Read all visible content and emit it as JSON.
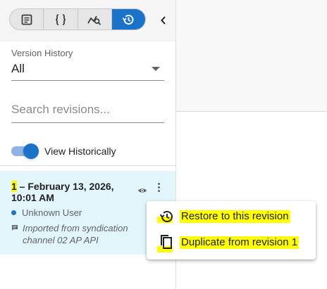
{
  "toolbar": {
    "tabs": [
      {
        "name": "document-icon",
        "active": false
      },
      {
        "name": "code-braces-icon",
        "active": false
      },
      {
        "name": "chart-search-icon",
        "active": false
      },
      {
        "name": "history-icon",
        "active": true
      }
    ],
    "collapse_icon": "chevron-left-icon"
  },
  "version_history": {
    "label": "Version History",
    "selected": "All"
  },
  "search": {
    "placeholder": "Search revisions..."
  },
  "toggle": {
    "label": "View Historically",
    "on": true
  },
  "revision": {
    "number": "1",
    "title_rest": " – February 13, 2026, 10:01 AM",
    "user": "Unknown User",
    "comment": "Imported from syndication channel 02 AP API"
  },
  "menu": {
    "restore_label": "Restore to this revision",
    "duplicate_label": "Duplicate from revision 1"
  },
  "colors": {
    "accent": "#1a73c8",
    "revision_bg": "#e1f5fb",
    "highlight": "#ffff00"
  }
}
